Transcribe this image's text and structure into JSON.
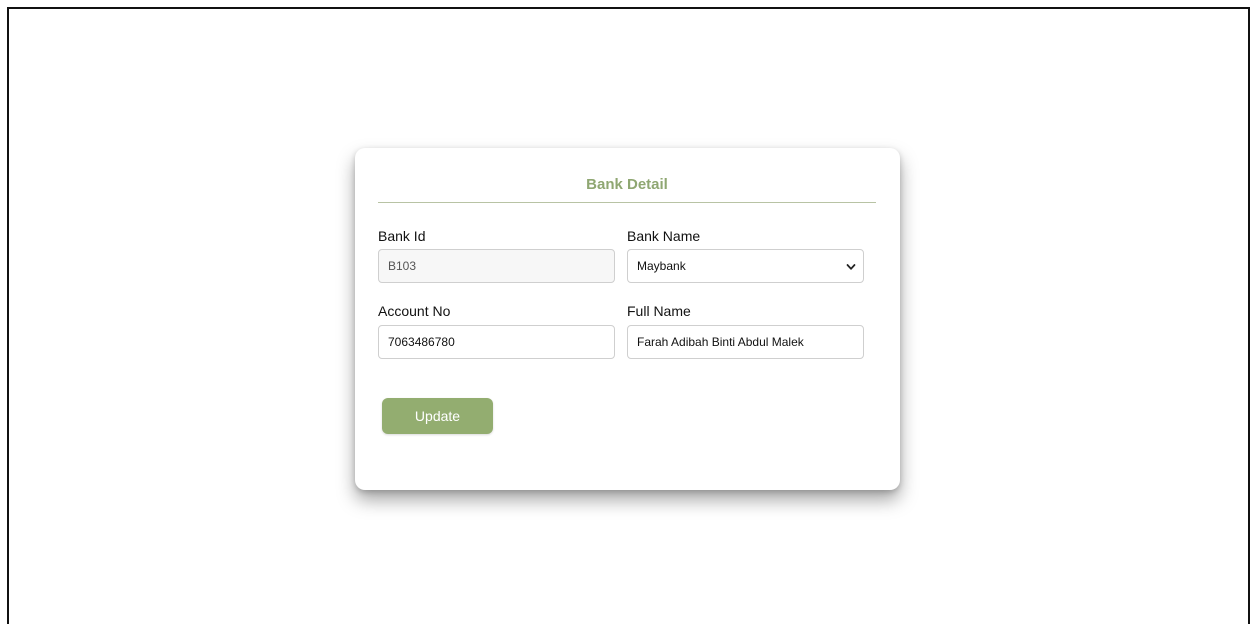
{
  "form": {
    "title": "Bank Detail",
    "bank_id": {
      "label": "Bank Id",
      "value": "B103"
    },
    "bank_name": {
      "label": "Bank Name",
      "value": "Maybank"
    },
    "account_no": {
      "label": "Account No",
      "value": "7063486780"
    },
    "full_name": {
      "label": "Full Name",
      "value": "Farah Adibah Binti Abdul Malek"
    },
    "update_label": "Update"
  },
  "icons": {
    "select_caret": "chevron-down-icon"
  },
  "colors": {
    "accent": "#8fa772",
    "button": "#93ad70",
    "rule": "#b8c3a4"
  }
}
